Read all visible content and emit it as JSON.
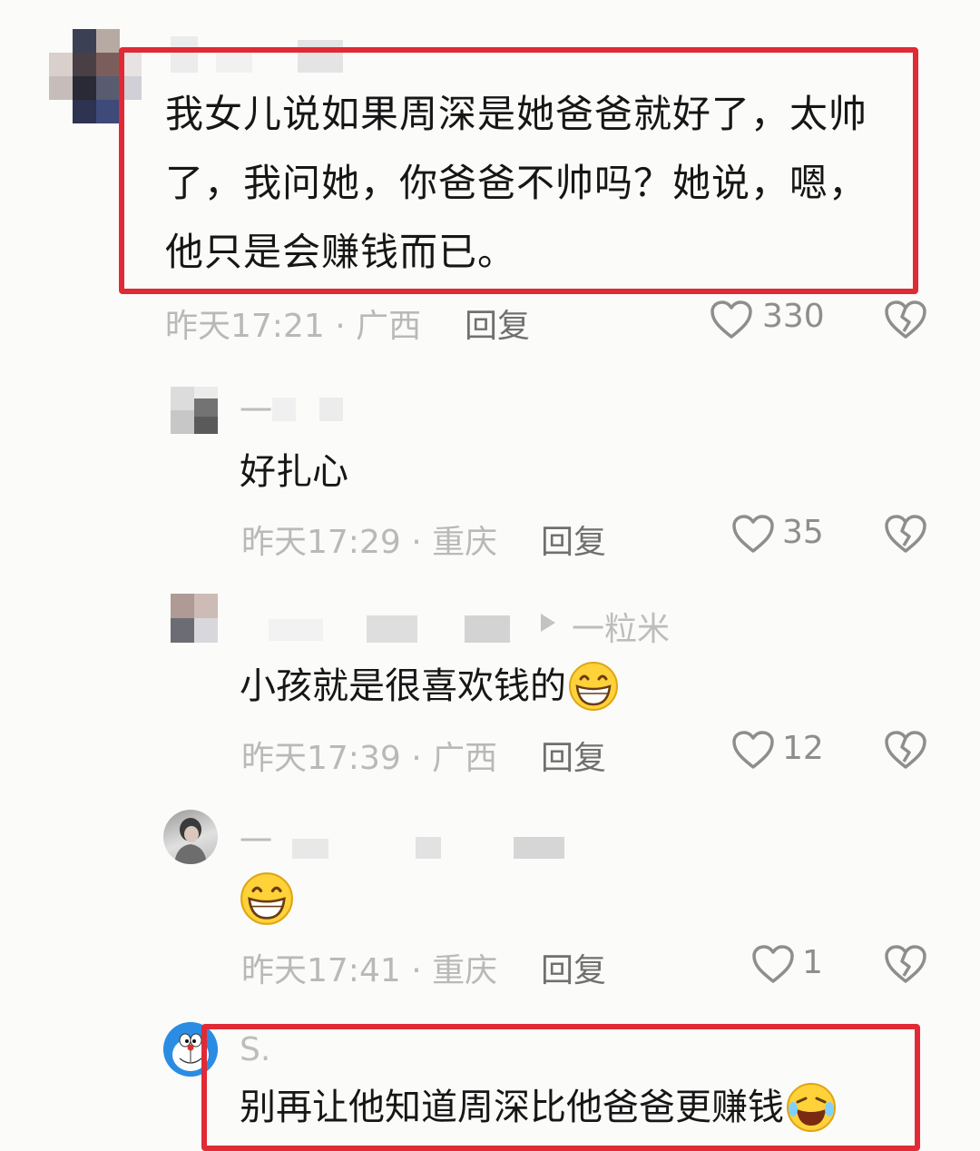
{
  "comments": [
    {
      "text": "我女儿说如果周深是她爸爸就好了，太帅了，我问她，你爸爸不帅吗？她说，嗯，他只是会赚钱而已。",
      "lines": [
        "我女儿说如果周深是她爸爸就好了，太帅",
        "了，我问她，你爸爸不帅吗？她说，嗯，",
        "他只是会赚钱而已。"
      ],
      "meta": "昨天17:21 · 广西",
      "reply_label": "回复",
      "likes": "330"
    }
  ],
  "replies": [
    {
      "username": "一",
      "text": "好扎心",
      "meta": "昨天17:29 · 重庆",
      "reply_label": "回复",
      "likes": "35"
    },
    {
      "reply_to": "一粒米",
      "text": "小孩就是很喜欢钱的",
      "emoji": "grinning-face",
      "meta": "昨天17:39 · 广西",
      "reply_label": "回复",
      "likes": "12"
    },
    {
      "username": "一",
      "text": "",
      "emoji": "grinning-face",
      "meta": "昨天17:41 · 重庆",
      "reply_label": "回复",
      "likes": "1"
    },
    {
      "username": "S.",
      "text": "别再让他知道周深比他爸爸更赚钱",
      "emoji": "laughing-face"
    }
  ],
  "colors": {
    "highlight_border": "#e02a35",
    "meta_gray": "#b9b9b9",
    "background": "#fbfbf9"
  }
}
